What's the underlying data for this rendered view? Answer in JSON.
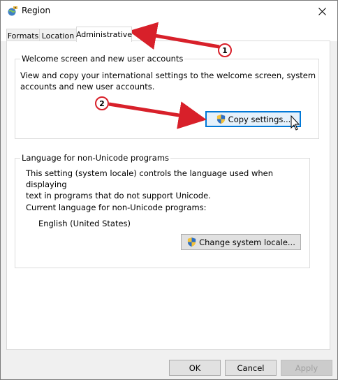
{
  "window": {
    "title": "Region",
    "close_icon": "close-icon",
    "app_icon": "region-globe-icon"
  },
  "tabs": [
    {
      "label": "Formats"
    },
    {
      "label": "Location"
    },
    {
      "label": "Administrative",
      "active": true
    }
  ],
  "welcome_group": {
    "label": "Welcome screen and new user accounts",
    "description_line1": "View and copy your international settings to the welcome screen, system",
    "description_line2": "accounts and new user accounts.",
    "copy_button": "Copy settings..."
  },
  "unicode_group": {
    "label": "Language for non-Unicode programs",
    "description_line1": "This setting (system locale) controls the language used when displaying",
    "description_line2": "text in programs that do not support Unicode.",
    "current_label": "Current language for non-Unicode programs:",
    "current_value": "English (United States)",
    "change_button": "Change system locale..."
  },
  "footer": {
    "ok": "OK",
    "cancel": "Cancel",
    "apply": "Apply"
  },
  "annotations": [
    {
      "number": "1"
    },
    {
      "number": "2"
    }
  ],
  "colors": {
    "arrow": "#d8202a",
    "focus": "#0078d7"
  }
}
